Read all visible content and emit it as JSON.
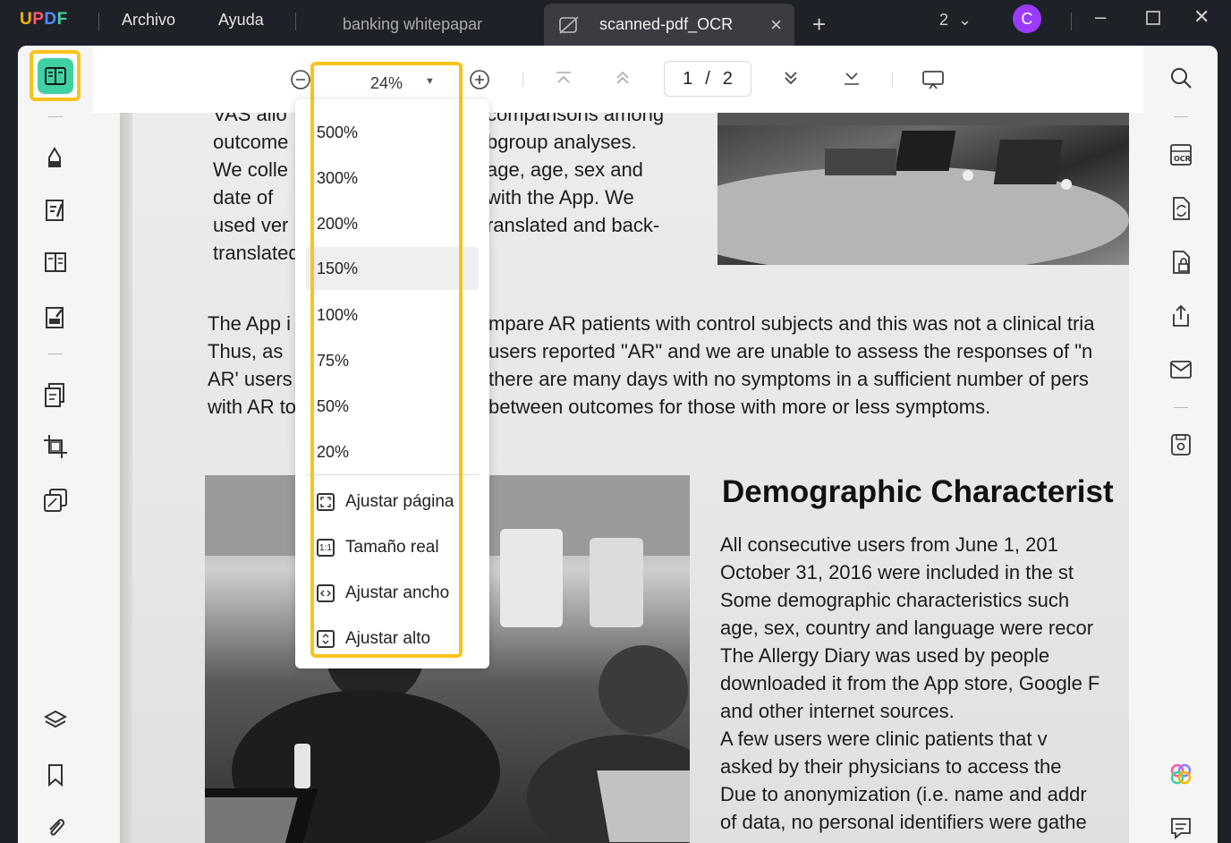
{
  "app": {
    "logo": "UPDF"
  },
  "menu": {
    "file": "Archivo",
    "help": "Ayuda"
  },
  "tabs": [
    {
      "label": "banking whitepapar"
    },
    {
      "label": "scanned-pdf_OCR"
    }
  ],
  "window": {
    "count": "2",
    "avatar": "C"
  },
  "toolbar": {
    "zoom_value": "24%",
    "page_current": "1",
    "page_separator": "/",
    "page_total": "2"
  },
  "zoom_menu": {
    "presets": [
      "500%",
      "300%",
      "200%",
      "150%",
      "100%",
      "75%",
      "50%",
      "20%"
    ],
    "highlighted": "150%",
    "fit_options": [
      "Ajustar página",
      "Tamaño real",
      "Ajustar ancho",
      "Ajustar alto"
    ],
    "fit_icon_real_size": "1:1"
  },
  "document": {
    "top_left_lines": [
      "VAS allo",
      "outcome",
      "We  colle",
      "date  of",
      "used ver",
      "translated"
    ],
    "top_mid_lines": [
      "comparisons among",
      "bgroup analyses.",
      "age,  age,  sex  and",
      "with  the  App.  We",
      "ranslated and back-"
    ],
    "mid_left_lines": [
      "The App i",
      "Thus, as",
      "AR' users",
      "with AR to"
    ],
    "mid_right_lines": [
      "mpare AR patients with control subjects and this was not a clinical tria",
      "users reported \"AR\" and we are unable to assess the responses of \"n",
      "there are many days with no symptoms in a sufficient number of pers",
      "between outcomes for those with more or less symptoms."
    ],
    "heading": "Demographic Characterist",
    "section_lines": [
      "All  consecutive  users  from  June  1,  201",
      "October  31,  2016  were  included  in  the  st",
      "Some   demographic   characteristics   such",
      "age, sex, country and language were recor",
      "The  Allergy  Diary  was  used  by  people",
      "downloaded it from the App store, Google F",
      "and other internet sources.",
      "A   few   users   were   clinic   patients   that   v",
      "asked  by  their  physicians  to  access  the  ",
      "Due to anonymization (i.e. name and addr",
      "of data, no personal identifiers were gathe"
    ]
  },
  "colors": {
    "highlight": "#fbc21b",
    "accent_green": "#3fd0a4",
    "avatar": "#9b3bff"
  }
}
